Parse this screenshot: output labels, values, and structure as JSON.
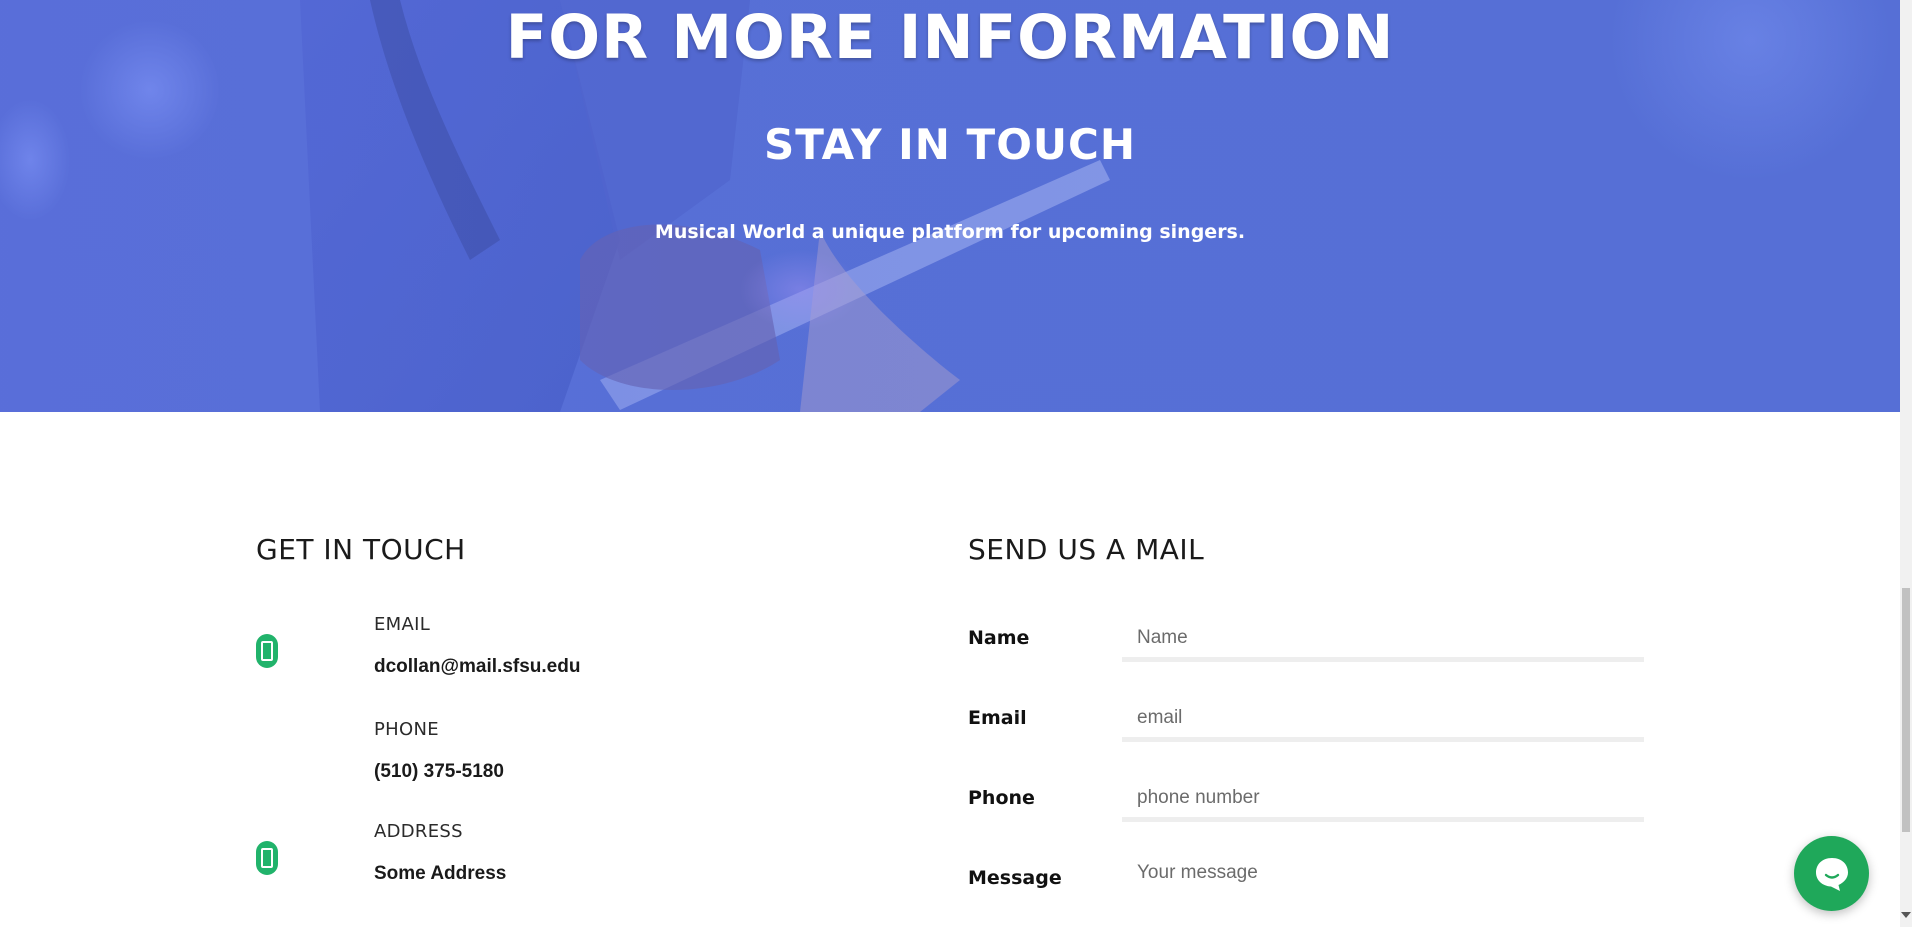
{
  "hero": {
    "title": "FOR MORE INFORMATION",
    "subtitle": "STAY IN TOUCH",
    "tagline": "Musical World a unique platform for upcoming singers."
  },
  "contact": {
    "heading": "GET IN TOUCH",
    "items": [
      {
        "label": "EMAIL",
        "value": "dcollan@mail.sfsu.edu",
        "icon": "phone-device-icon"
      },
      {
        "label": "PHONE",
        "value": "(510) 375-5180"
      },
      {
        "label": "ADDRESS",
        "value": "Some Address",
        "icon": "phone-device-icon"
      }
    ]
  },
  "mail_form": {
    "heading": "SEND US A MAIL",
    "fields": [
      {
        "label": "Name",
        "placeholder": "Name"
      },
      {
        "label": "Email",
        "placeholder": "email"
      },
      {
        "label": "Phone",
        "placeholder": "phone number"
      },
      {
        "label": "Message",
        "placeholder": "Your message"
      }
    ]
  },
  "chat_widget": {
    "icon": "chat-bubble-icon"
  },
  "colors": {
    "hero_blue": "#5a72d6",
    "accent_green": "#21b36b",
    "chat_green": "#1fa85a"
  }
}
